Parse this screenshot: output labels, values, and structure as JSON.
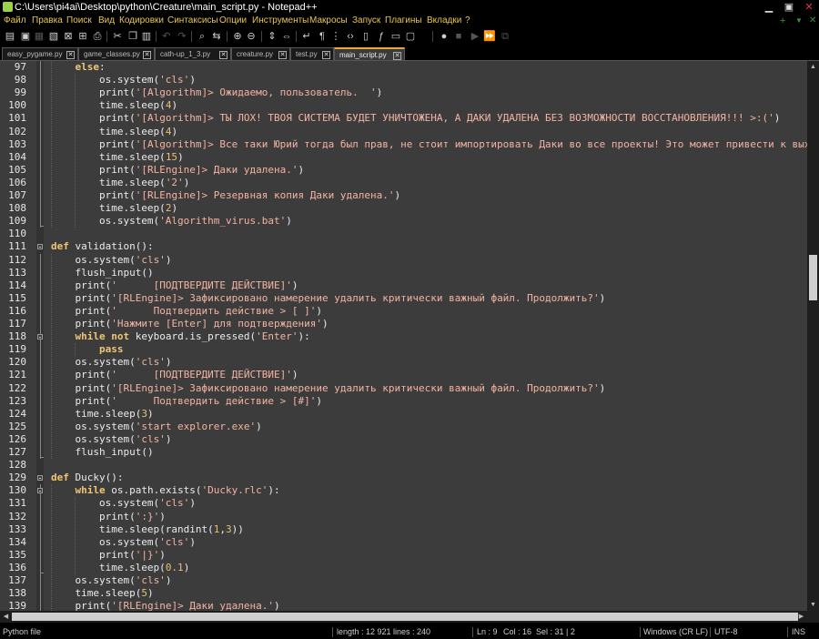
{
  "window": {
    "title": "C:\\Users\\pi4ai\\Desktop\\python\\Creature\\main_script.py - Notepad++",
    "buttons": [
      "▁",
      "▣",
      "✕"
    ]
  },
  "menu": {
    "items": [
      "Файл",
      "Правка",
      "Поиск",
      "Вид",
      "Кодировки",
      "Синтаксисы",
      "Опции",
      "Инструменты",
      "Макросы",
      "Запуск",
      "Плагины",
      "Вкладки",
      "?"
    ],
    "right": [
      "+",
      "▼",
      "✕"
    ]
  },
  "toolbar": {
    "icons": [
      "new-file-icon",
      "open-icon",
      "save-icon",
      "save-all-icon",
      "close-icon",
      "close-all-icon",
      "print-icon",
      "cut-icon",
      "copy-icon",
      "paste-icon",
      "undo-icon",
      "redo-icon",
      "find-icon",
      "replace-icon",
      "zoom-in-icon",
      "zoom-out-icon",
      "sync-v-icon",
      "sync-h-icon",
      "wrap-icon",
      "all-chars-icon",
      "indent-guide-icon",
      "lang-icon",
      "doc-map-icon",
      "func-list-icon",
      "folder-workspace-icon",
      "monitor-icon",
      "record-icon",
      "stop-icon",
      "play-icon",
      "play-multi-icon",
      "save-macro-icon"
    ]
  },
  "tabs": [
    {
      "label": "easy_pygame.py",
      "active": false
    },
    {
      "label": "game_classes.py",
      "active": false
    },
    {
      "label": "cath-up_1_3.py",
      "active": false
    },
    {
      "label": "creature.py",
      "active": false
    },
    {
      "label": "test.py",
      "active": false
    },
    {
      "label": "main_script.py",
      "active": true
    }
  ],
  "editor": {
    "language": "Python",
    "lines": [
      {
        "n": "97",
        "indent": 1,
        "tokens": [
          {
            "t": "else",
            "c": "kw"
          },
          {
            "t": ":",
            "c": ""
          }
        ]
      },
      {
        "n": "98",
        "indent": 2,
        "tokens": [
          {
            "t": "os.system(",
            "c": ""
          },
          {
            "t": "'cls'",
            "c": "st"
          },
          {
            "t": ")",
            "c": ""
          }
        ]
      },
      {
        "n": "99",
        "indent": 2,
        "tokens": [
          {
            "t": "print(",
            "c": ""
          },
          {
            "t": "'[Algorithm]> Ожидаемо, пользователь.  '",
            "c": "st"
          },
          {
            "t": ")",
            "c": ""
          }
        ]
      },
      {
        "n": "100",
        "indent": 2,
        "tokens": [
          {
            "t": "time.sleep(",
            "c": ""
          },
          {
            "t": "4",
            "c": "num"
          },
          {
            "t": ")",
            "c": ""
          }
        ]
      },
      {
        "n": "101",
        "indent": 2,
        "tokens": [
          {
            "t": "print(",
            "c": ""
          },
          {
            "t": "'[Algorithm]> ТЫ ЛОХ! ТВОЯ СИСТЕМА БУДЕТ УНИЧТОЖЕНА, А ДАКИ УДАЛЕНА БЕЗ ВОЗМОЖНОСТИ ВОССТАНОВЛЕНИЯ!!! >:('",
            "c": "st"
          },
          {
            "t": ")",
            "c": ""
          }
        ]
      },
      {
        "n": "102",
        "indent": 2,
        "tokens": [
          {
            "t": "time.sleep(",
            "c": ""
          },
          {
            "t": "4",
            "c": "num"
          },
          {
            "t": ")",
            "c": ""
          }
        ]
      },
      {
        "n": "103",
        "indent": 2,
        "tokens": [
          {
            "t": "print(",
            "c": ""
          },
          {
            "t": "'[Algorithm]> Все таки Юрий тогда был прав, не стоит импортировать Даки во все проекты! Это может привести к выходу и",
            "c": "st"
          }
        ]
      },
      {
        "n": "104",
        "indent": 2,
        "tokens": [
          {
            "t": "time.sleep(",
            "c": ""
          },
          {
            "t": "15",
            "c": "num"
          },
          {
            "t": ")",
            "c": ""
          }
        ]
      },
      {
        "n": "105",
        "indent": 2,
        "tokens": [
          {
            "t": "print(",
            "c": ""
          },
          {
            "t": "'[RLEngine]> Даки удалена.'",
            "c": "st"
          },
          {
            "t": ")",
            "c": ""
          }
        ]
      },
      {
        "n": "106",
        "indent": 2,
        "tokens": [
          {
            "t": "time.sleep(",
            "c": ""
          },
          {
            "t": "'2'",
            "c": "st"
          },
          {
            "t": ")",
            "c": ""
          }
        ]
      },
      {
        "n": "107",
        "indent": 2,
        "tokens": [
          {
            "t": "print(",
            "c": ""
          },
          {
            "t": "'[RLEngine]> Резервная копия Даки удалена.'",
            "c": "st"
          },
          {
            "t": ")",
            "c": ""
          }
        ]
      },
      {
        "n": "108",
        "indent": 2,
        "tokens": [
          {
            "t": "time.sleep(",
            "c": ""
          },
          {
            "t": "2",
            "c": "num"
          },
          {
            "t": ")",
            "c": ""
          }
        ]
      },
      {
        "n": "109",
        "indent": 2,
        "tokens": [
          {
            "t": "os.system(",
            "c": ""
          },
          {
            "t": "'Algorithm_virus.bat'",
            "c": "st"
          },
          {
            "t": ")",
            "c": ""
          }
        ]
      },
      {
        "n": "110",
        "indent": 0,
        "tokens": []
      },
      {
        "n": "111",
        "indent": 0,
        "tokens": [
          {
            "t": "def",
            "c": "kw"
          },
          {
            "t": " validation():",
            "c": ""
          }
        ]
      },
      {
        "n": "112",
        "indent": 1,
        "tokens": [
          {
            "t": "os.system(",
            "c": ""
          },
          {
            "t": "'cls'",
            "c": "st"
          },
          {
            "t": ")",
            "c": ""
          }
        ]
      },
      {
        "n": "113",
        "indent": 1,
        "tokens": [
          {
            "t": "flush_input()",
            "c": ""
          }
        ]
      },
      {
        "n": "114",
        "indent": 1,
        "tokens": [
          {
            "t": "print(",
            "c": ""
          },
          {
            "t": "'      [ПОДТВЕРДИТЕ ДЕЙСТВИЕ]'",
            "c": "st"
          },
          {
            "t": ")",
            "c": ""
          }
        ]
      },
      {
        "n": "115",
        "indent": 1,
        "tokens": [
          {
            "t": "print(",
            "c": ""
          },
          {
            "t": "'[RLEngine]> Зафиксировано намерение удалить критически важный файл. Продолжить?'",
            "c": "st"
          },
          {
            "t": ")",
            "c": ""
          }
        ]
      },
      {
        "n": "116",
        "indent": 1,
        "tokens": [
          {
            "t": "print(",
            "c": ""
          },
          {
            "t": "'      Подтвердить действие > [ ]'",
            "c": "st"
          },
          {
            "t": ")",
            "c": ""
          }
        ]
      },
      {
        "n": "117",
        "indent": 1,
        "tokens": [
          {
            "t": "print(",
            "c": ""
          },
          {
            "t": "'Нажмите [Enter] для подтверждения'",
            "c": "st"
          },
          {
            "t": ")",
            "c": ""
          }
        ]
      },
      {
        "n": "118",
        "indent": 1,
        "tokens": [
          {
            "t": "while",
            "c": "kw"
          },
          {
            "t": " ",
            "c": ""
          },
          {
            "t": "not",
            "c": "kw"
          },
          {
            "t": " keyboard.is_pressed(",
            "c": ""
          },
          {
            "t": "'Enter'",
            "c": "st"
          },
          {
            "t": "):",
            "c": ""
          }
        ]
      },
      {
        "n": "119",
        "indent": 2,
        "tokens": [
          {
            "t": "pass",
            "c": "kw"
          }
        ]
      },
      {
        "n": "120",
        "indent": 1,
        "tokens": [
          {
            "t": "os.system(",
            "c": ""
          },
          {
            "t": "'cls'",
            "c": "st"
          },
          {
            "t": ")",
            "c": ""
          }
        ]
      },
      {
        "n": "121",
        "indent": 1,
        "tokens": [
          {
            "t": "print(",
            "c": ""
          },
          {
            "t": "'      [ПОДТВЕРДИТЕ ДЕЙСТВИЕ]'",
            "c": "st"
          },
          {
            "t": ")",
            "c": ""
          }
        ]
      },
      {
        "n": "122",
        "indent": 1,
        "tokens": [
          {
            "t": "print(",
            "c": ""
          },
          {
            "t": "'[RLEngine]> Зафиксировано намерение удалить критически важный файл. Продолжить?'",
            "c": "st"
          },
          {
            "t": ")",
            "c": ""
          }
        ]
      },
      {
        "n": "123",
        "indent": 1,
        "tokens": [
          {
            "t": "print(",
            "c": ""
          },
          {
            "t": "'      Подтвердить действие > [#]'",
            "c": "st"
          },
          {
            "t": ")",
            "c": ""
          }
        ]
      },
      {
        "n": "124",
        "indent": 1,
        "tokens": [
          {
            "t": "time.sleep(",
            "c": ""
          },
          {
            "t": "3",
            "c": "num"
          },
          {
            "t": ")",
            "c": ""
          }
        ]
      },
      {
        "n": "125",
        "indent": 1,
        "tokens": [
          {
            "t": "os.system(",
            "c": ""
          },
          {
            "t": "'start explorer.exe'",
            "c": "st"
          },
          {
            "t": ")",
            "c": ""
          }
        ]
      },
      {
        "n": "126",
        "indent": 1,
        "tokens": [
          {
            "t": "os.system(",
            "c": ""
          },
          {
            "t": "'cls'",
            "c": "st"
          },
          {
            "t": ")",
            "c": ""
          }
        ]
      },
      {
        "n": "127",
        "indent": 1,
        "tokens": [
          {
            "t": "flush_input()",
            "c": ""
          }
        ]
      },
      {
        "n": "128",
        "indent": 0,
        "tokens": []
      },
      {
        "n": "129",
        "indent": 0,
        "tokens": [
          {
            "t": "def",
            "c": "kw"
          },
          {
            "t": " Ducky():",
            "c": ""
          }
        ]
      },
      {
        "n": "130",
        "indent": 1,
        "tokens": [
          {
            "t": "while",
            "c": "kw"
          },
          {
            "t": " os.path.exists(",
            "c": ""
          },
          {
            "t": "'Ducky.rlc'",
            "c": "st"
          },
          {
            "t": "):",
            "c": ""
          }
        ]
      },
      {
        "n": "131",
        "indent": 2,
        "tokens": [
          {
            "t": "os.system(",
            "c": ""
          },
          {
            "t": "'cls'",
            "c": "st"
          },
          {
            "t": ")",
            "c": ""
          }
        ]
      },
      {
        "n": "132",
        "indent": 2,
        "tokens": [
          {
            "t": "print(",
            "c": ""
          },
          {
            "t": "':}'",
            "c": "st"
          },
          {
            "t": ")",
            "c": ""
          }
        ]
      },
      {
        "n": "133",
        "indent": 2,
        "tokens": [
          {
            "t": "time.sleep(randint(",
            "c": ""
          },
          {
            "t": "1",
            "c": "num"
          },
          {
            "t": ",",
            "c": ""
          },
          {
            "t": "3",
            "c": "num"
          },
          {
            "t": "))",
            "c": ""
          }
        ]
      },
      {
        "n": "134",
        "indent": 2,
        "tokens": [
          {
            "t": "os.system(",
            "c": ""
          },
          {
            "t": "'cls'",
            "c": "st"
          },
          {
            "t": ")",
            "c": ""
          }
        ]
      },
      {
        "n": "135",
        "indent": 2,
        "tokens": [
          {
            "t": "print(",
            "c": ""
          },
          {
            "t": "'|}'",
            "c": "st"
          },
          {
            "t": ")",
            "c": ""
          }
        ]
      },
      {
        "n": "136",
        "indent": 2,
        "tokens": [
          {
            "t": "time.sleep(",
            "c": ""
          },
          {
            "t": "0.1",
            "c": "num"
          },
          {
            "t": ")",
            "c": ""
          }
        ]
      },
      {
        "n": "137",
        "indent": 1,
        "tokens": [
          {
            "t": "os.system(",
            "c": ""
          },
          {
            "t": "'cls'",
            "c": "st"
          },
          {
            "t": ")",
            "c": ""
          }
        ]
      },
      {
        "n": "138",
        "indent": 1,
        "tokens": [
          {
            "t": "time.sleep(",
            "c": ""
          },
          {
            "t": "5",
            "c": "num"
          },
          {
            "t": ")",
            "c": ""
          }
        ]
      },
      {
        "n": "139",
        "indent": 1,
        "tokens": [
          {
            "t": "print(",
            "c": ""
          },
          {
            "t": "'[RLEngine]> Даки удалена.'",
            "c": "st"
          },
          {
            "t": ")",
            "c": ""
          }
        ]
      }
    ]
  },
  "status": {
    "file_type": "Python file",
    "length": "length : 12 921",
    "lines": "lines : 240",
    "ln": "Ln : 9",
    "col": "Col : 16",
    "sel": "Sel : 31 | 2",
    "eol": "Windows (CR LF)",
    "encoding": "UTF-8",
    "mode": "INS"
  },
  "colors": {
    "editor_bg": "#3c3c3c",
    "keyword": "#f0c674",
    "string": "#f4b3a2",
    "number": "#e8c070",
    "menu_text": "#e8c84a",
    "tab_accent": "#e8a540"
  }
}
